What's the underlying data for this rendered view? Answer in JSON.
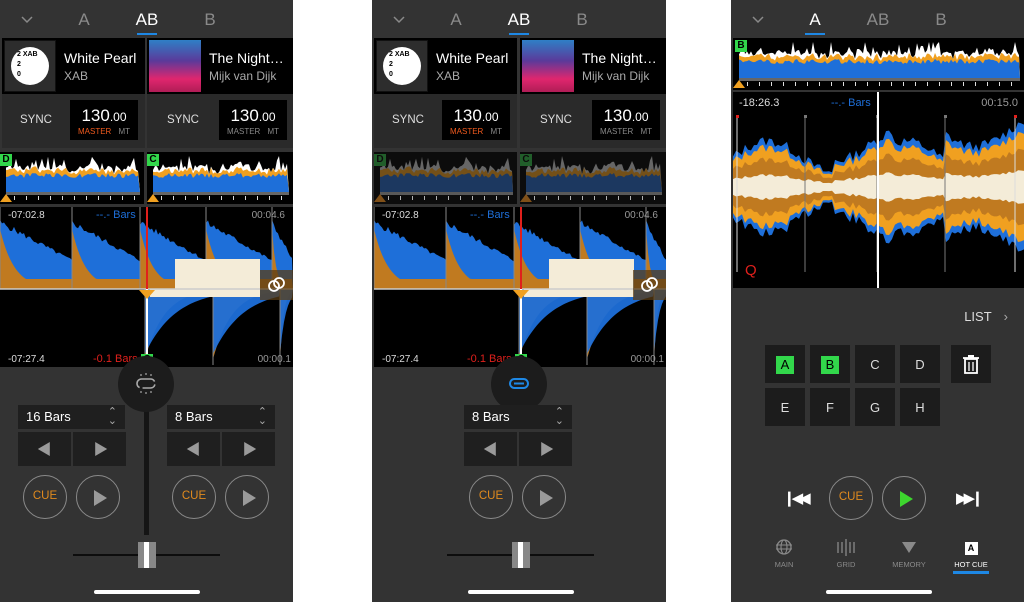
{
  "screens": [
    {
      "tabs": [
        {
          "label": "A"
        },
        {
          "label": "AB",
          "active": true
        },
        {
          "label": "B"
        }
      ],
      "decks": [
        {
          "title": "White Pearl",
          "artist": "XAB",
          "sync": "SYNC",
          "bpm_int": "130",
          "bpm_dec": ".00",
          "master": "MASTER",
          "master_on": true,
          "mt": "MT",
          "art": "white-disc"
        },
        {
          "title": "The Night…",
          "artist": "Mijk van Dijk",
          "sync": "SYNC",
          "bpm_int": "130",
          "bpm_dec": ".00",
          "master": "MASTER",
          "master_on": false,
          "mt": "MT",
          "art": "night-sky"
        }
      ],
      "overview_cues": [
        "D",
        "C"
      ],
      "wave_top": {
        "remaining": "-07:02.8",
        "bars": "--.- Bars",
        "elapsed": "00:04.6"
      },
      "wave_bottom": {
        "remaining": "-07:27.4",
        "bars": "-0.1 Bars",
        "elapsed": "00:00.1",
        "cue": "C"
      },
      "beat_sync": "unlinked",
      "loops": [
        {
          "value": "16 Bars"
        },
        {
          "value": "8 Bars"
        }
      ],
      "cue_label": "CUE",
      "crossfader_position": 0.5
    },
    {
      "tabs": [
        {
          "label": "A"
        },
        {
          "label": "AB",
          "active": true
        },
        {
          "label": "B"
        }
      ],
      "decks": [
        {
          "title": "White Pearl",
          "artist": "XAB",
          "sync": "SYNC",
          "bpm_int": "130",
          "bpm_dec": ".00",
          "master": "MASTER",
          "master_on": true,
          "mt": "MT",
          "art": "white-disc"
        },
        {
          "title": "The Night…",
          "artist": "Mijk van Dijk",
          "sync": "SYNC",
          "bpm_int": "130",
          "bpm_dec": ".00",
          "master": "MASTER",
          "master_on": false,
          "mt": "MT",
          "art": "night-sky"
        }
      ],
      "overview_cues": [
        "D",
        "C"
      ],
      "wave_top": {
        "remaining": "-07:02.8",
        "bars": "--.- Bars",
        "elapsed": "00:04.6"
      },
      "wave_bottom": {
        "remaining": "-07:27.4",
        "bars": "-0.1 Bars",
        "elapsed": "00:00.1",
        "cue": "C"
      },
      "beat_sync": "linked",
      "loops": [
        {
          "value": "8 Bars"
        }
      ],
      "cue_label": "CUE",
      "crossfader_position": 0.5
    },
    {
      "tabs": [
        {
          "label": "A",
          "active": true
        },
        {
          "label": "AB"
        },
        {
          "label": "B"
        }
      ],
      "overview_cue": "B",
      "wave": {
        "remaining": "-18:26.3",
        "bars": "--.- Bars",
        "elapsed": "00:15.0",
        "quantize": "Q"
      },
      "list_label": "LIST",
      "hot_cues": [
        {
          "label": "A",
          "set": true
        },
        {
          "label": "B",
          "set": true
        },
        {
          "label": "C",
          "set": false
        },
        {
          "label": "D",
          "set": false
        },
        {
          "label": "E",
          "set": false
        },
        {
          "label": "F",
          "set": false
        },
        {
          "label": "G",
          "set": false
        },
        {
          "label": "H",
          "set": false
        }
      ],
      "cue_label": "CUE",
      "playing": true,
      "bottom_nav": [
        {
          "label": "MAIN",
          "icon": "globe-icon"
        },
        {
          "label": "GRID",
          "icon": "grid-icon"
        },
        {
          "label": "MEMORY",
          "icon": "memory-triangle-icon"
        },
        {
          "label": "HOT CUE",
          "icon": "hot-cue-icon",
          "active": true,
          "badge": "A"
        }
      ]
    }
  ],
  "colors": {
    "accent": "#1e88e5",
    "cue_orange": "#e08a1e",
    "master_orange": "#f05a1e",
    "hotcue_green": "#32d74b",
    "play_green": "#3dd62e",
    "wave_blue": "#1e6fd9",
    "wave_orange": "#f0a020",
    "wave_brown": "#c07a20",
    "wave_cream": "#f4ecd8",
    "playhead_red": "#e0201c"
  }
}
